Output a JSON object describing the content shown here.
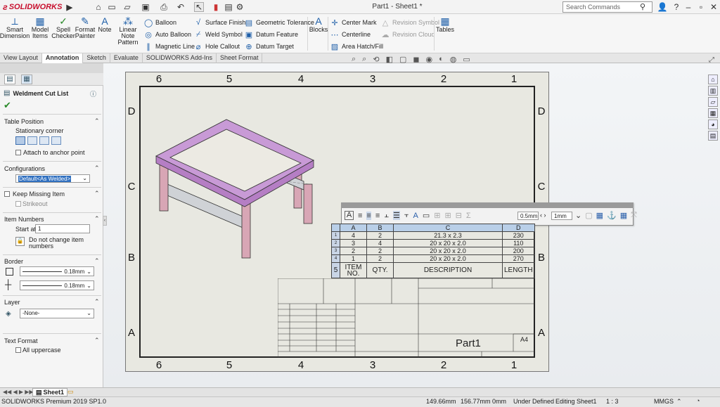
{
  "titlebar": {
    "logo_text": "SOLIDWORKS",
    "document_title": "Part1 - Sheet1 *",
    "search_placeholder": "Search Commands"
  },
  "ribbon": {
    "big_buttons": [
      {
        "label": "Smart Dimension",
        "icon": "smart-dimension-icon"
      },
      {
        "label": "Model Items",
        "icon": "model-items-icon"
      },
      {
        "label": "Spell Checker",
        "icon": "spell-checker-icon"
      },
      {
        "label": "Format Painter",
        "icon": "format-painter-icon"
      },
      {
        "label": "Note",
        "icon": "note-icon"
      },
      {
        "label": "Linear Note Pattern",
        "icon": "linear-note-pattern-icon"
      }
    ],
    "col1": [
      "Balloon",
      "Auto Balloon",
      "Magnetic Line"
    ],
    "col2": [
      "Surface Finish",
      "Weld Symbol",
      "Hole Callout"
    ],
    "col3": [
      "Geometric Tolerance",
      "Datum Feature",
      "Datum Target"
    ],
    "blocks_label": "Blocks",
    "col4": [
      "Center Mark",
      "Centerline",
      "Area Hatch/Fill"
    ],
    "col5": [
      "Revision Symbol",
      "Revision Cloud"
    ],
    "tables_label": "Tables"
  },
  "tabs": [
    "View Layout",
    "Annotation",
    "Sketch",
    "Evaluate",
    "SOLIDWORKS Add-Ins",
    "Sheet Format"
  ],
  "active_tab": "Annotation",
  "property_manager": {
    "title": "Weldment Cut List",
    "table_position": {
      "title": "Table Position",
      "stationary_corner_label": "Stationary corner",
      "attach_label": "Attach to anchor point"
    },
    "configurations": {
      "title": "Configurations",
      "value": "Default<As Welded>"
    },
    "keep_missing": {
      "title": "Keep Missing Item",
      "strikeout_label": "Strikeout"
    },
    "item_numbers": {
      "title": "Item Numbers",
      "start_at_label": "Start at:",
      "start_at_value": "1",
      "do_not_change_label": "Do not change item numbers"
    },
    "border": {
      "title": "Border",
      "box_border": "0.18mm",
      "grid_border": "0.18mm"
    },
    "layer": {
      "title": "Layer",
      "value": "-None-"
    },
    "text_format": {
      "title": "Text Format",
      "uppercase_label": "All uppercase"
    }
  },
  "drawing": {
    "zone_cols_top": [
      "6",
      "5",
      "4",
      "3",
      "2",
      "1"
    ],
    "zone_cols_bottom": [
      "6",
      "5",
      "4",
      "3",
      "2",
      "1"
    ],
    "zone_rows": [
      "D",
      "C",
      "B",
      "A"
    ],
    "part_name": "Part1",
    "sheet_size": "A4"
  },
  "table_toolbar": {
    "text_height": "0.5mm",
    "border": "1mm"
  },
  "weldment_table": {
    "col_letters": [
      "A",
      "B",
      "C",
      "D"
    ],
    "rows": [
      {
        "n": "1",
        "item": "4",
        "qty": "2",
        "desc": "21.3 x 2.3",
        "len": "230"
      },
      {
        "n": "2",
        "item": "3",
        "qty": "4",
        "desc": "20 x 20 x 2.0",
        "len": "110"
      },
      {
        "n": "3",
        "item": "2",
        "qty": "2",
        "desc": "20 x 20 x 2.0",
        "len": "200"
      },
      {
        "n": "4",
        "item": "1",
        "qty": "2",
        "desc": "20 x 20 x 2.0",
        "len": "270"
      }
    ],
    "header_row_num": "5",
    "headers": [
      "ITEM NO.",
      "QTY.",
      "DESCRIPTION",
      "LENGTH"
    ]
  },
  "sheet_tab": "Sheet1",
  "status": {
    "product": "SOLIDWORKS Premium 2019 SP1.0",
    "x": "149.66mm",
    "y": "156.77mm",
    "z": "0mm",
    "state": "Under Defined",
    "mode": "Editing Sheet1",
    "scale": "1 : 3",
    "units": "MMGS"
  },
  "colors": {
    "frame_purple": "#c89ad6",
    "leg_pink": "#d8a6b5",
    "tube_grey": "#cfd2d6",
    "table_header_blue": "#b9cfe8"
  }
}
